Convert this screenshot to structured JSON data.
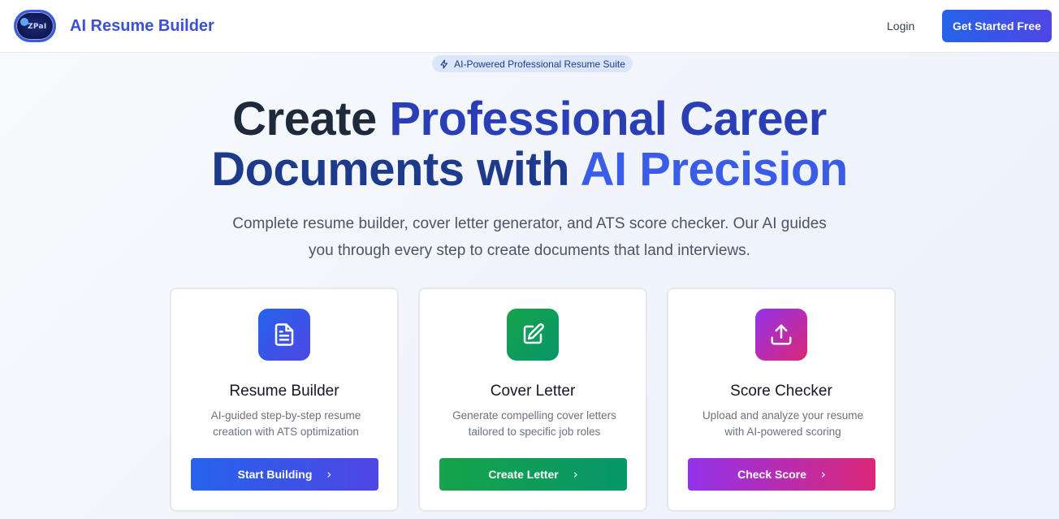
{
  "header": {
    "logo_text": "ZPaI",
    "brand": "AI Resume Builder",
    "login": "Login",
    "cta": "Get Started Free"
  },
  "badge": {
    "icon": "lightning-icon",
    "text": "AI-Powered Professional Resume Suite"
  },
  "hero": {
    "line1_a": "Create ",
    "line1_b": "Professional Career",
    "line2_a": "Documents with ",
    "line2_b": "AI Precision",
    "subtitle_line1": "Complete resume builder, cover letter generator, and ATS score checker. Our AI guides",
    "subtitle_line2": "you through every step to create documents that land interviews."
  },
  "cards": [
    {
      "icon": "document-icon",
      "title": "Resume Builder",
      "desc_line1": "AI-guided step-by-step resume",
      "desc_line2": "creation with ATS optimization",
      "button": "Start Building",
      "colors": [
        "#2563eb",
        "#4f46e5"
      ]
    },
    {
      "icon": "edit-icon",
      "title": "Cover Letter",
      "desc_line1": "Generate compelling cover letters",
      "desc_line2": "tailored to specific job roles",
      "button": "Create Letter",
      "colors": [
        "#16a34a",
        "#059669"
      ]
    },
    {
      "icon": "upload-icon",
      "title": "Score Checker",
      "desc_line1": "Upload and analyze your resume",
      "desc_line2": "with AI-powered scoring",
      "button": "Check Score",
      "colors": [
        "#9333ea",
        "#db2777"
      ]
    }
  ]
}
